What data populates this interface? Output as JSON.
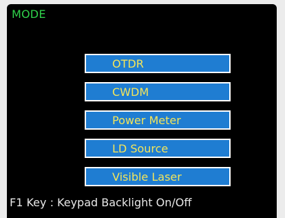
{
  "header": {
    "title": "MODE"
  },
  "menu": {
    "items": [
      {
        "label": "OTDR"
      },
      {
        "label": "CWDM"
      },
      {
        "label": "Power Meter"
      },
      {
        "label": "LD Source"
      },
      {
        "label": "Visible Laser"
      }
    ]
  },
  "footer": {
    "hint": "F1 Key : Keypad Backlight On/Off"
  },
  "colors": {
    "title_text": "#2fd14a",
    "item_background": "#1f7dd2",
    "item_border": "#ffffff",
    "item_text": "#f4e55a",
    "screen_background": "#000000",
    "footer_text": "#e8e8e8"
  }
}
